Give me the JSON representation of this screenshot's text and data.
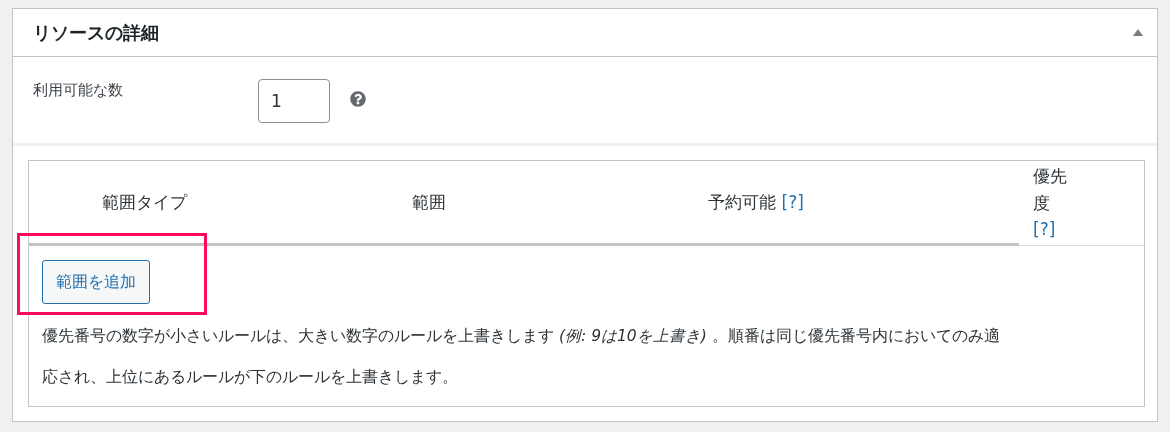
{
  "panel": {
    "title": "リソースの詳細",
    "expanded": true
  },
  "quantity": {
    "label": "利用可能な数",
    "value": "1"
  },
  "table": {
    "columns": [
      {
        "label": "範囲タイプ"
      },
      {
        "label": "範囲"
      },
      {
        "label": "予約可能",
        "help": "[?]"
      },
      {
        "label": "優先度",
        "help": "[?]"
      }
    ]
  },
  "add_button": "範囲を追加",
  "note": "優先番号の数字が小さいルールは、大きい数字のルールを上書きします *(例: 9は10を上書き)* 。順番は同じ優先番号内においてのみ適応され、上位にあるルールが下のルールを上書きします。"
}
